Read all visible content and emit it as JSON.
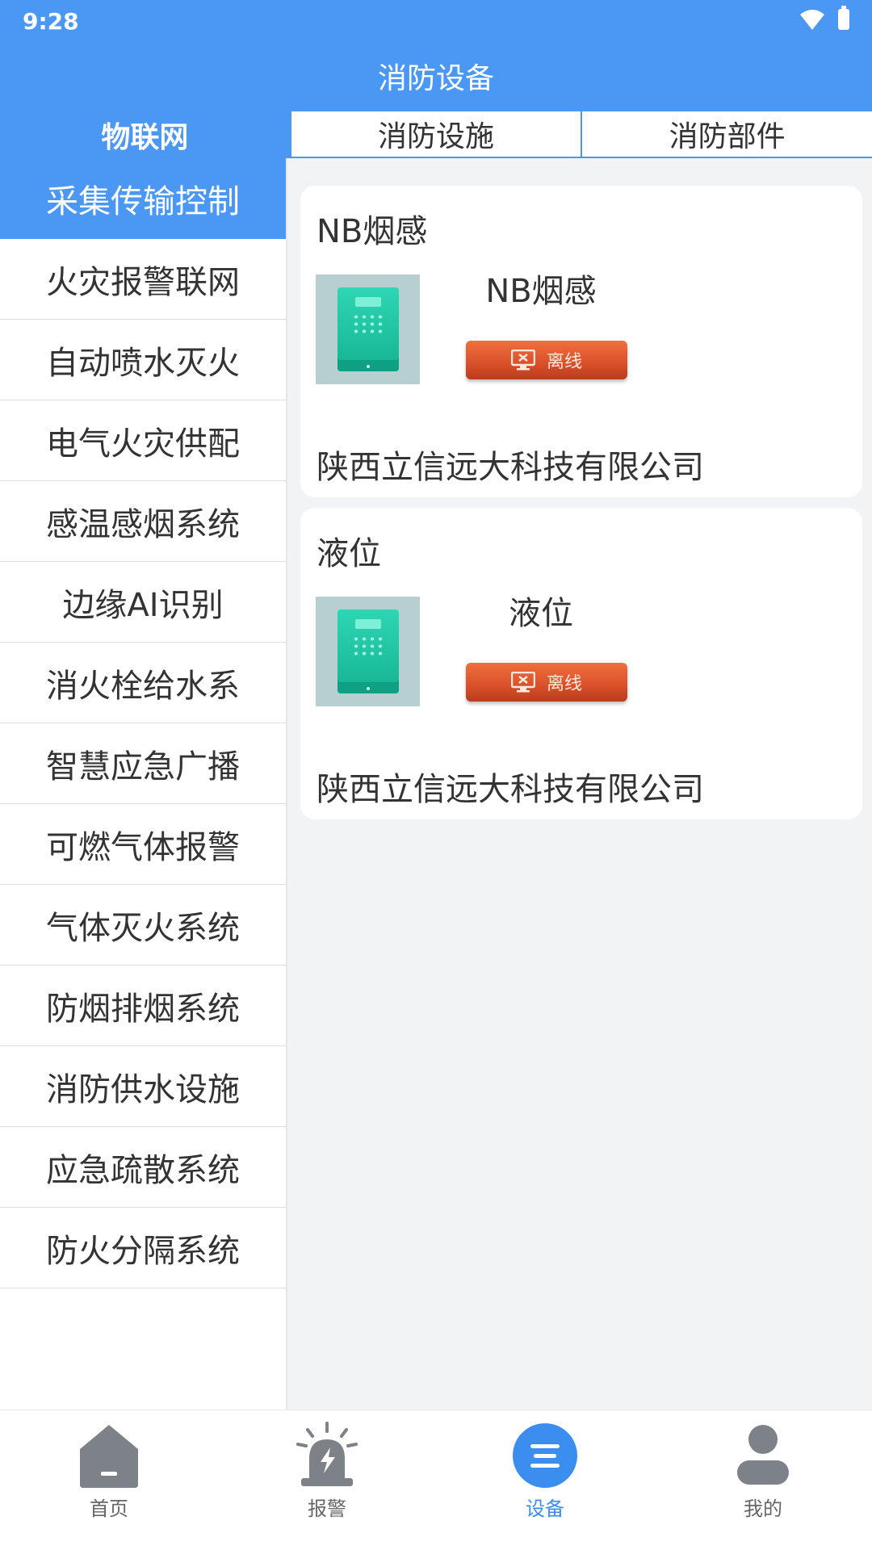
{
  "status_bar": {
    "time": "9:28"
  },
  "header": {
    "title": "消防设备"
  },
  "tabs": [
    {
      "label": "物联网",
      "active": true
    },
    {
      "label": "消防设施",
      "active": false
    },
    {
      "label": "消防部件",
      "active": false
    }
  ],
  "sidebar": {
    "items": [
      {
        "label": "采集传输控制",
        "active": true
      },
      {
        "label": "火灾报警联网"
      },
      {
        "label": "自动喷水灭火"
      },
      {
        "label": "电气火灾供配"
      },
      {
        "label": "感温感烟系统"
      },
      {
        "label": "边缘AI识别"
      },
      {
        "label": "消火栓给水系"
      },
      {
        "label": "智慧应急广播"
      },
      {
        "label": "可燃气体报警"
      },
      {
        "label": "气体灭火系统"
      },
      {
        "label": "防烟排烟系统"
      },
      {
        "label": "消防供水设施"
      },
      {
        "label": "应急疏散系统"
      },
      {
        "label": "防火分隔系统"
      }
    ]
  },
  "devices": [
    {
      "title": "NB烟感",
      "name": "NB烟感",
      "status": "离线",
      "company": "陕西立信远大科技有限公司"
    },
    {
      "title": "液位",
      "name": "液位",
      "status": "离线",
      "company": "陕西立信远大科技有限公司"
    }
  ],
  "bottom_nav": [
    {
      "label": "首页",
      "icon": "home-icon",
      "active": false
    },
    {
      "label": "报警",
      "icon": "alarm-icon",
      "active": false
    },
    {
      "label": "设备",
      "icon": "device-list-icon",
      "active": true
    },
    {
      "label": "我的",
      "icon": "user-icon",
      "active": false
    }
  ],
  "colors": {
    "primary": "#4a97f4",
    "offline": "#d9502a",
    "active_nav": "#3b8ef0"
  }
}
